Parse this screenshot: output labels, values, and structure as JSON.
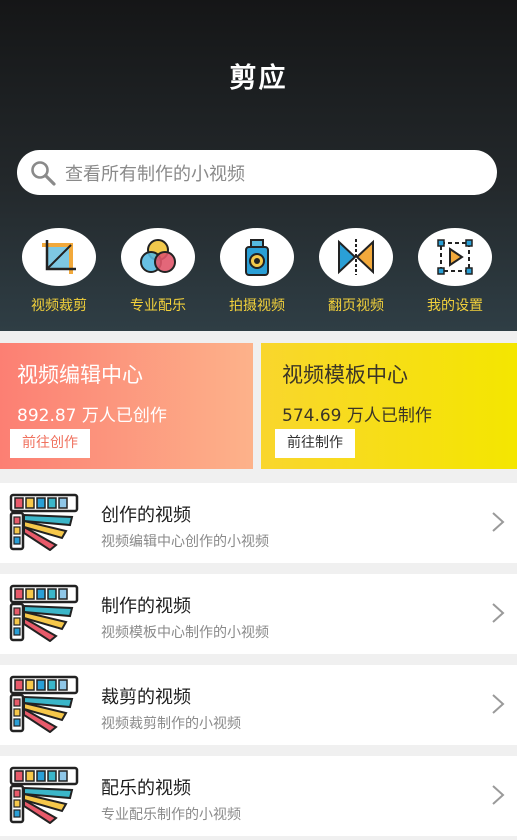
{
  "header": {
    "title": "剪应"
  },
  "search": {
    "placeholder": "查看所有制作的小视频"
  },
  "shortcuts": [
    {
      "label": "视频裁剪",
      "icon": "crop-icon"
    },
    {
      "label": "专业配乐",
      "icon": "color-circles-icon"
    },
    {
      "label": "拍摄视频",
      "icon": "camera-icon"
    },
    {
      "label": "翻页视频",
      "icon": "page-flip-icon"
    },
    {
      "label": "我的设置",
      "icon": "settings-icon"
    }
  ],
  "cards": [
    {
      "title": "视频编辑中心",
      "stat": "892.87 万人已创作",
      "button": "前往创作"
    },
    {
      "title": "视频模板中心",
      "stat": "574.69 万人已制作",
      "button": "前往制作"
    }
  ],
  "list": [
    {
      "title": "创作的视频",
      "subtitle": "视频编辑中心创作的小视频"
    },
    {
      "title": "制作的视频",
      "subtitle": "视频模板中心制作的小视频"
    },
    {
      "title": "裁剪的视频",
      "subtitle": "视频裁剪制作的小视频"
    },
    {
      "title": "配乐的视频",
      "subtitle": "专业配乐制作的小视频"
    }
  ],
  "colors": {
    "accent_yellow": "#f2d13b",
    "card_left": "#fc7f73",
    "card_right": "#f9d62d"
  }
}
